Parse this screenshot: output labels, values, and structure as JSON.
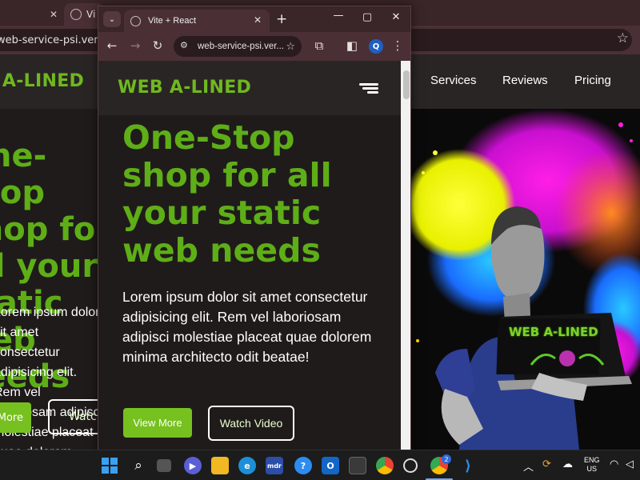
{
  "background_window": {
    "tab_title": "Vi",
    "url": "web-service-psi.vercel.app",
    "site": {
      "brand": "WEB A-LINED",
      "nav": [
        "Services",
        "Reviews",
        "Pricing"
      ],
      "hero_title": "One-Stop shop for all your static web needs",
      "hero_body": "Lorem ipsum dolor sit amet consectetur adipisicing elit. Rem vel laboriosam adipisci molestiae placeat quae dolorem minima architecto odit beatae!",
      "btn_more": "View More",
      "btn_watch": "Watch Video"
    },
    "art": {
      "laptop_text": "WEB A-LINED"
    }
  },
  "foreground_window": {
    "tab_title": "Vite + React",
    "url": "web-service-psi.ver...",
    "profile_initial": "Q",
    "site": {
      "brand": "WEB A-LINED",
      "hero_title": "One-Stop shop for all your static web needs",
      "hero_body": "Lorem ipsum dolor sit amet consectetur adipisicing elit. Rem vel laboriosam adipisci molestiae placeat quae dolorem minima architecto odit beatae!",
      "btn_more": "View More",
      "btn_watch": "Watch Video"
    }
  },
  "taskbar": {
    "language": "ENG",
    "region": "US",
    "notification_badge": "2"
  },
  "colors": {
    "brand_green": "#6fb81f",
    "button_green": "#76c11f",
    "page_bg": "#201b1b",
    "chrome_frame": "#4a3034"
  }
}
